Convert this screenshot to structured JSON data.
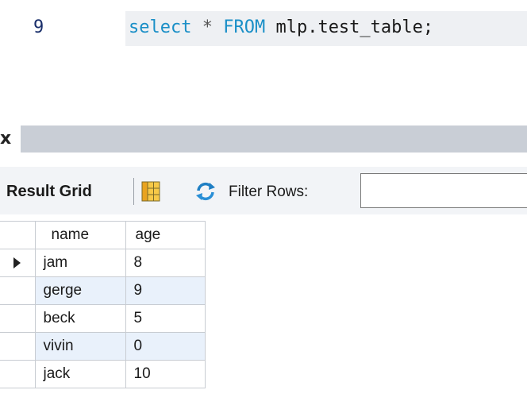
{
  "editor": {
    "line_number": "9",
    "code_tokens": [
      {
        "text": "select",
        "kind": "keyword"
      },
      {
        "text": " ",
        "kind": "plain"
      },
      {
        "text": "*",
        "kind": "operator"
      },
      {
        "text": " ",
        "kind": "plain"
      },
      {
        "text": "FROM",
        "kind": "keyword"
      },
      {
        "text": " mlp.test_table;",
        "kind": "plain"
      }
    ]
  },
  "result_tab": {
    "close_glyph": "x"
  },
  "toolbar": {
    "result_grid_label": "Result Grid",
    "filter_label": "Filter Rows:",
    "filter_value": ""
  },
  "grid": {
    "columns": [
      "name",
      "age"
    ],
    "rows": [
      {
        "name": "jam",
        "age": "8",
        "current": true
      },
      {
        "name": "gerge",
        "age": "9",
        "current": false
      },
      {
        "name": "beck",
        "age": "5",
        "current": false
      },
      {
        "name": "vivin",
        "age": "0",
        "current": false
      },
      {
        "name": "jack",
        "age": "10",
        "current": false
      }
    ]
  },
  "colors": {
    "keyword": "#1a8fc7",
    "tab_bar": "#c9ced6",
    "toolbar": "#f2f4f7",
    "alt_row": "#e9f1fb",
    "code_highlight": "#eef0f3"
  },
  "icons": {
    "grid_layout": "grid-layout-icon",
    "refresh": "refresh-icon",
    "row_pointer": "row-pointer-icon"
  }
}
